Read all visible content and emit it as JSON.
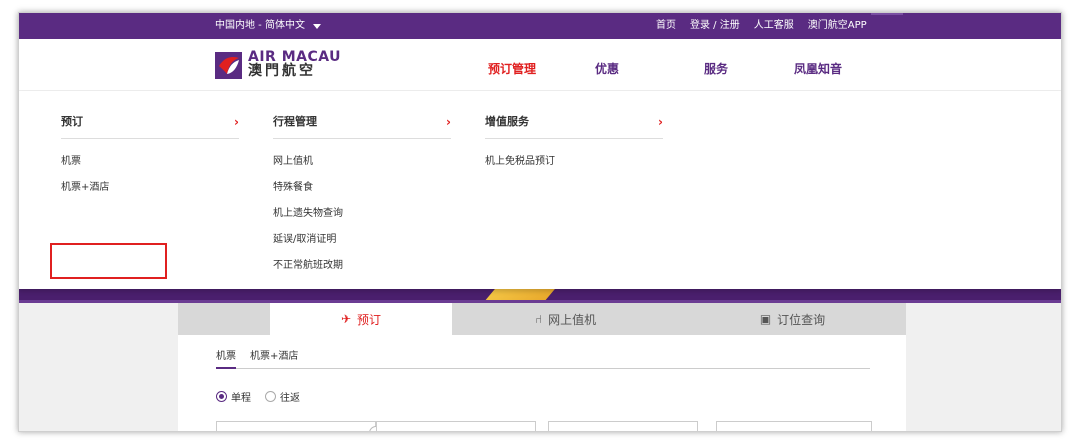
{
  "topbar": {
    "region": "中国内地 - 简体中文",
    "links": [
      "首页",
      "登录 / 注册",
      "人工客服",
      "澳门航空APP"
    ]
  },
  "header": {
    "logo_en": "AIR MACAU",
    "logo_zh": "澳門航空",
    "nav": [
      "预订管理",
      "优惠",
      "服务",
      "凤凰知音"
    ]
  },
  "menu": {
    "columns": [
      {
        "title": "预订",
        "items": [
          "机票",
          "机票+酒店"
        ]
      },
      {
        "title": "行程管理",
        "items": [
          "网上值机",
          "特殊餐食",
          "机上遗失物查询",
          "延误/取消证明",
          "不正常航班改期"
        ]
      },
      {
        "title": "增值服务",
        "items": [
          "机上免税品预订"
        ]
      }
    ],
    "highlighted_item": "机票+酒店"
  },
  "booking": {
    "tabs": [
      "预订",
      "网上值机",
      "订位查询"
    ],
    "subtabs": [
      "机票",
      "机票+酒店"
    ],
    "trip_types": [
      "单程",
      "往返"
    ],
    "selected_trip": "单程"
  },
  "colors": {
    "brand": "#5a2b82",
    "accent": "#e02020"
  }
}
